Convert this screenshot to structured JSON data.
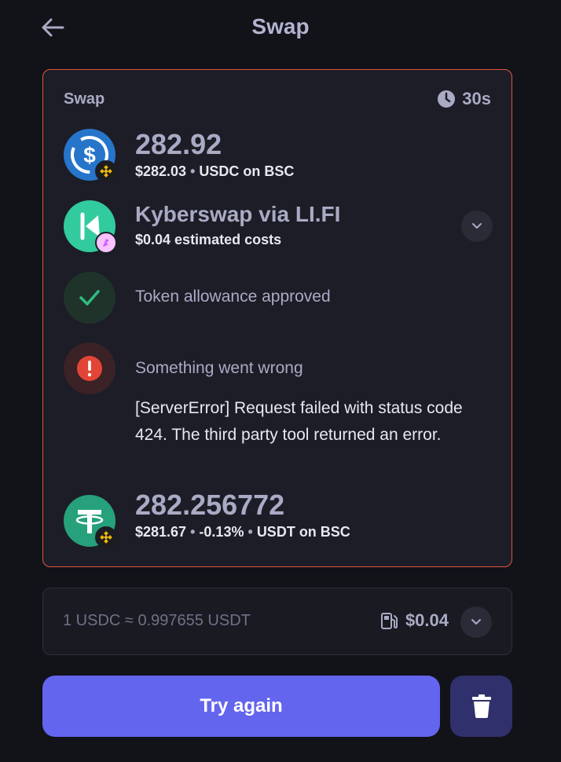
{
  "header": {
    "title": "Swap",
    "back_icon": "arrow-left-icon"
  },
  "card": {
    "label": "Swap",
    "timer": "30s",
    "from": {
      "amount": "282.92",
      "usd_value": "$282.03",
      "token_chain": "USDC on BSC",
      "token_icon": "usdc-icon",
      "chain_icon": "bnb-icon"
    },
    "route": {
      "name": "Kyberswap via LI.FI",
      "costs": "$0.04 estimated costs",
      "icon": "kyberswap-icon",
      "badge_icon": "lifi-icon"
    },
    "allowance": {
      "text": "Token allowance approved",
      "icon": "check-icon"
    },
    "error": {
      "title": "Something went wrong",
      "message": "[ServerError] Request failed with status code 424. The third party tool returned an error.",
      "icon": "error-icon"
    },
    "to": {
      "amount": "282.256772",
      "usd_value": "$281.67",
      "price_impact": "-0.13%",
      "token_chain": "USDT on BSC",
      "token_icon": "usdt-icon",
      "chain_icon": "bnb-icon"
    }
  },
  "rate_bar": {
    "rate": "1 USDC ≈ 0.997655 USDT",
    "gas": "$0.04"
  },
  "actions": {
    "try_again": "Try again"
  },
  "colors": {
    "accent": "#6465ee",
    "error_border": "#e1573c",
    "success": "#2ebd7f",
    "error": "#e24536",
    "usdc": "#2775ca",
    "usdt": "#26a17b",
    "kyber": "#31cb9e"
  },
  "bullet": "•"
}
